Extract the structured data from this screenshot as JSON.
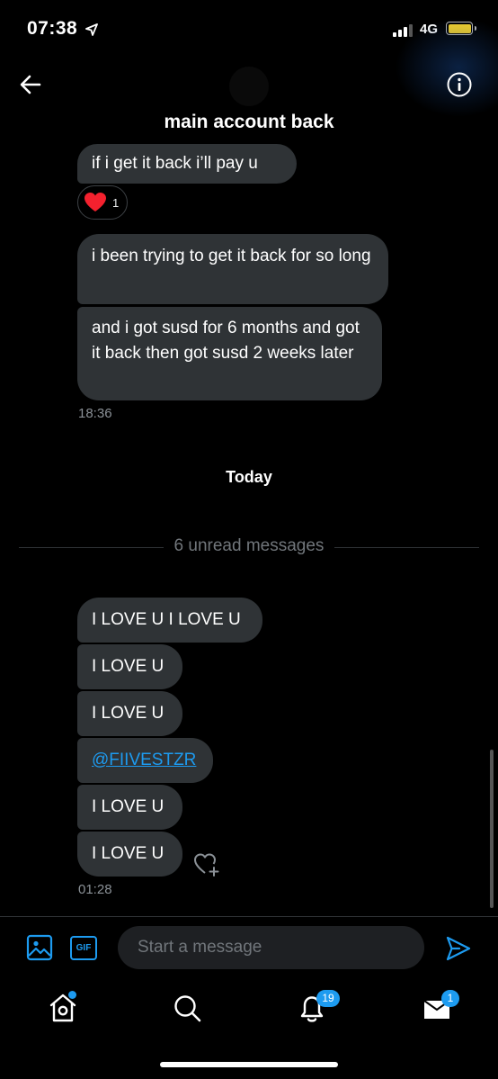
{
  "status_bar": {
    "time": "07:38",
    "network": "4G"
  },
  "header": {
    "title": "main account back"
  },
  "messages_before": [
    {
      "text": "if i get it back i’ll pay u"
    },
    {
      "text": "i been trying to get it back for so long"
    },
    {
      "text": "and i got susd for 6 months and got it back then got susd 2 weeks later"
    }
  ],
  "reaction": {
    "count": "1"
  },
  "timestamp_1": "18:36",
  "day_label": "Today",
  "unread_label": "6 unread messages",
  "messages_today": [
    {
      "text": "I LOVE U I LOVE U"
    },
    {
      "text": "I LOVE U"
    },
    {
      "text": "I LOVE U"
    },
    {
      "text": "@FIIVESTZR"
    },
    {
      "text": "I LOVE U"
    },
    {
      "text": "I LOVE U"
    }
  ],
  "timestamp_2": "01:28",
  "composer": {
    "placeholder": "Start a message",
    "gif_label": "GIF"
  },
  "tab_bar": {
    "notifications_badge": "19",
    "messages_badge": "1"
  },
  "colors": {
    "accent": "#1d9bf0",
    "bubble": "#2f3336",
    "heart": "#f4212e"
  }
}
